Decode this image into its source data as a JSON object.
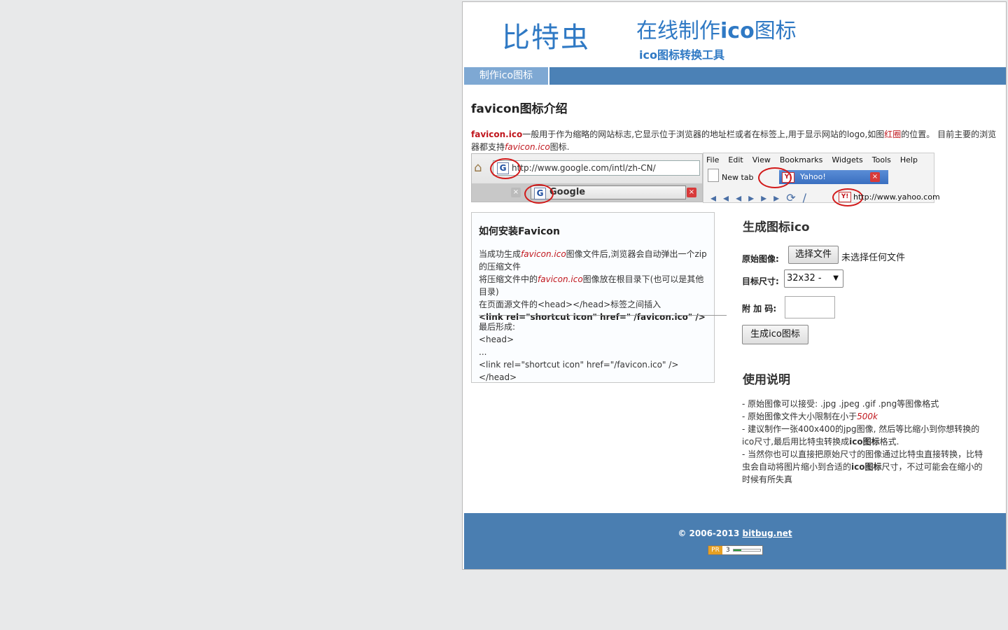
{
  "header": {
    "brand": "比特虫",
    "title_pre": "在线制作",
    "title_bold": "ico",
    "title_post": "图标",
    "subtitle": "ico图标转换工具"
  },
  "nav": {
    "tab_label": "制作ico图标"
  },
  "intro": {
    "title": "favicon图标介绍",
    "lead": "favicon.ico",
    "text1": "一般用于作为缩略的网站标志,它显示位于浏览器的地址栏或者在标签上,用于显示网站的logo,如图",
    "red_circle": "红圈",
    "text2": "的位置。 目前主要的浏览器都支持",
    "favicon_em": "favicon.ico",
    "text3": "图标."
  },
  "screenshot_google": {
    "url": "http://www.google.com/intl/zh-CN/",
    "tab_title": "Google",
    "icon_letter": "G"
  },
  "screenshot_yahoo": {
    "menu": [
      "File",
      "Edit",
      "View",
      "Bookmarks",
      "Widgets",
      "Tools",
      "Help"
    ],
    "new_tab": "New tab",
    "tab_title": "Yahoo!",
    "url": "http://www.yahoo.com",
    "icon_letter": "Y!"
  },
  "install": {
    "title": "如何安装Favicon",
    "line1_pre": "当成功生成",
    "line1_em": "favicon.ico",
    "line1_post": "图像文件后,浏览器会自动弹出一个zip的压缩文件",
    "line2_pre": "将压缩文件中的",
    "line2_em": "favicon.ico",
    "line2_post": "图像放在根目录下(也可以是其他目录)",
    "line3": "在页面源文件的<head></head>标签之间插入",
    "code": "<link rel=\"shortcut icon\" href=\" /favicon.ico\" />",
    "result_label": "最后形成:",
    "result_lines": [
      "<head>",
      "...",
      "<link rel=\"shortcut icon\" href=\"/favicon.ico\" />",
      "</head>"
    ]
  },
  "generator": {
    "title": "生成图标ico",
    "source_label": "原始图像:",
    "file_button": "选择文件",
    "file_status": "未选择任何文件",
    "size_label": "目标尺寸:",
    "size_value": "32x32 -",
    "extra_label": "附 加 码:",
    "extra_value": "",
    "submit": "生成ico图标"
  },
  "usage": {
    "title": "使用说明",
    "l1": "- 原始图像可以接受: .jpg .jpeg .gif .png等图像格式",
    "l2_pre": "- 原始图像文件大小限制在小于",
    "l2_em": "500k",
    "l3_pre": "- 建议制作一张400x400的jpg图像, 然后等比缩小到你想转换的ico尺寸,最后用比特虫转换成",
    "l3_bold": "ico图标",
    "l3_post": "格式.",
    "l4_pre": "- 当然你也可以直接把原始尺寸的图像通过比特虫直接转换，比特虫会自动将图片缩小到合适的",
    "l4_bold": "ico图标",
    "l4_post": "尺寸，不过可能会在缩小的时候有所失真"
  },
  "footer": {
    "copyright": "© 2006-2013",
    "link": "bitbug.net",
    "pr_label": "PR",
    "pr_value": "3"
  }
}
